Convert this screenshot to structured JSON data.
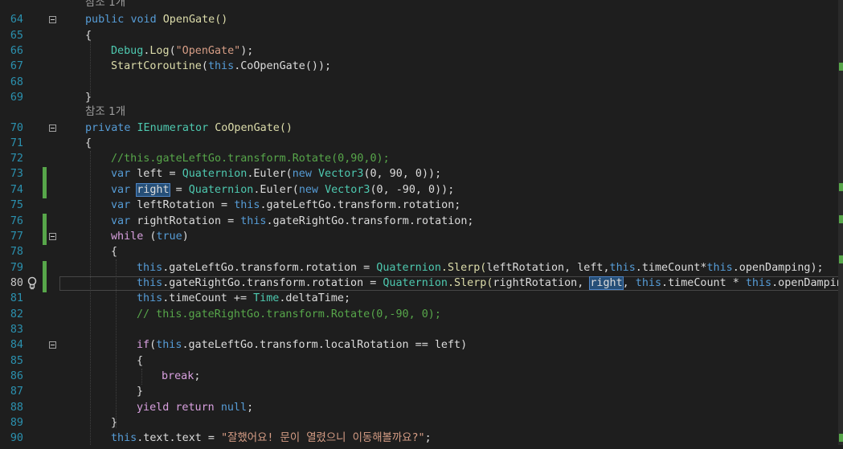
{
  "editor": {
    "codelens_top": "참조 1개",
    "codelens_mid": "참조 1개",
    "lines": {
      "l64": {
        "num": "64"
      },
      "l65": {
        "num": "65"
      },
      "l66": {
        "num": "66"
      },
      "l67": {
        "num": "67"
      },
      "l68": {
        "num": "68"
      },
      "l69": {
        "num": "69"
      },
      "l70": {
        "num": "70"
      },
      "l71": {
        "num": "71"
      },
      "l72": {
        "num": "72"
      },
      "l73": {
        "num": "73"
      },
      "l74": {
        "num": "74"
      },
      "l75": {
        "num": "75"
      },
      "l76": {
        "num": "76"
      },
      "l77": {
        "num": "77"
      },
      "l78": {
        "num": "78"
      },
      "l79": {
        "num": "79"
      },
      "l80": {
        "num": "80"
      },
      "l81": {
        "num": "81"
      },
      "l82": {
        "num": "82"
      },
      "l83": {
        "num": "83"
      },
      "l84": {
        "num": "84"
      },
      "l85": {
        "num": "85"
      },
      "l86": {
        "num": "86"
      },
      "l87": {
        "num": "87"
      },
      "l88": {
        "num": "88"
      },
      "l89": {
        "num": "89"
      },
      "l90": {
        "num": "90"
      }
    },
    "tokens": {
      "public": "public",
      "void": "void",
      "OpenGate": "OpenGate()",
      "brace_open": "{",
      "brace_close": "}",
      "Debug": "Debug",
      "dot_Log": ".",
      "Log": "Log",
      "paren_open": "(",
      "str_opengate": "\"OpenGate\"",
      "paren_close_semi": ");",
      "StartCoroutine": "StartCoroutine",
      "this": "this",
      "CoOpenGate_call": ".CoOpenGate());",
      "private": "private",
      "IEnumerator": "IEnumerator",
      "CoOpenGate_decl": "CoOpenGate()",
      "comment72": "//this.gateLeftGo.transform.Rotate(0,90,0);",
      "var": "var",
      "new": "new",
      "left": "left",
      "right": "right",
      "eq": " = ",
      "Quaternion": "Quaternion",
      "Euler": ".Euler(",
      "Vector3": "Vector3",
      "v_left": "(0, 90, 0));",
      "v_right": "(0, -90, 0));",
      "leftRotation": "leftRotation",
      "rightRotation": "rightRotation",
      "gateLeftRot": ".gateLeftGo.transform.rotation;",
      "gateRightRot": ".gateRightGo.transform.rotation;",
      "while": "while",
      "true": "true",
      "paren_o": "(",
      "paren_c": ")",
      "gateLeftAssign": ".gateLeftGo.transform.rotation = ",
      "gateRightAssign": ".gateRightGo.transform.rotation = ",
      "Slerp": ".Slerp(",
      "l79_args": "leftRotation, left,",
      "timeCount_times": ".timeCount*",
      "openDamping_end": ".openDamping);",
      "l80_args": "rightRotation, ",
      "comma_sp": ", ",
      "timeCount_times_sp": ".timeCount * ",
      "openDamping_end2": ".openDamping)",
      "timeCount_plus": ".timeCount += ",
      "Time": "Time",
      "deltaTime": ".deltaTime;",
      "comment82": "// this.gateRightGo.transform.Rotate(0,-90, 0);",
      "if": "if",
      "gateLeftLocal": ".gateLeftGo.transform.localRotation == left)",
      "break": "break",
      "semi": ";",
      "yield": "yield",
      "return": "return",
      "null": "null",
      "textText": ".text.text = ",
      "str_korean": "\"잘했어요! 문이 열렸으니 이동해볼까요?\""
    }
  },
  "colors": {
    "background": "#1e1e1e",
    "keyword": "#569cd6",
    "type": "#4ec9b0",
    "method": "#dcdcaa",
    "string": "#d69d85",
    "comment": "#57a64a",
    "line_number": "#2b91af",
    "change_marker": "#57a64a",
    "selection": "#264f78"
  },
  "icons": {
    "lightbulb": "lightbulb-icon",
    "collapse": "collapse-icon"
  }
}
